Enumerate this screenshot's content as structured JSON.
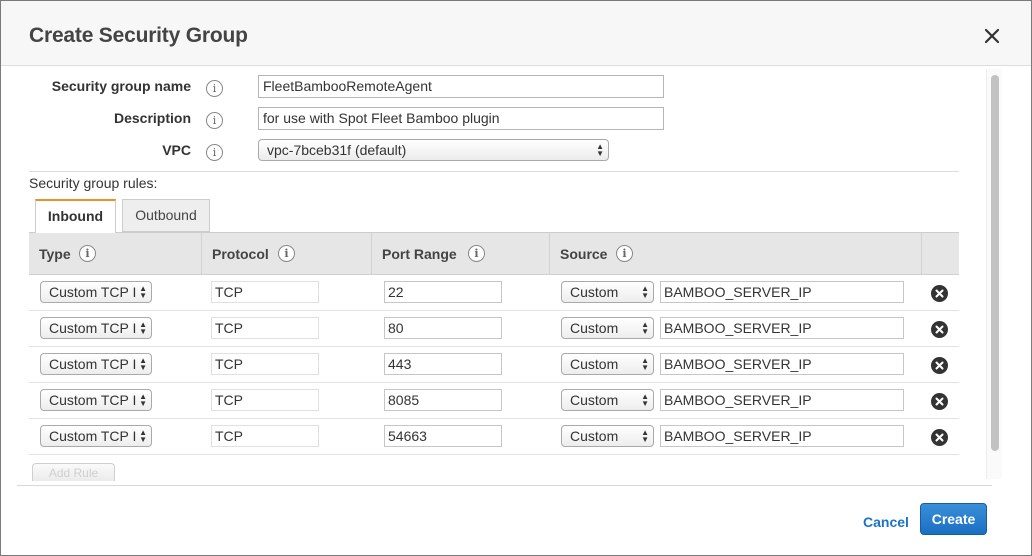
{
  "dialog": {
    "title": "Create Security Group",
    "close_icon": "close-icon"
  },
  "form": {
    "name_label": "Security group name",
    "name_value": "FleetBambooRemoteAgent",
    "description_label": "Description",
    "description_value": "for use with Spot Fleet Bamboo plugin",
    "vpc_label": "VPC",
    "vpc_value": "vpc-7bceb31f (default)",
    "info_glyph": "i"
  },
  "rules": {
    "label": "Security group rules:",
    "tabs": [
      {
        "label": "Inbound",
        "active": true
      },
      {
        "label": "Outbound",
        "active": false
      }
    ],
    "columns": {
      "type": "Type",
      "protocol": "Protocol",
      "port_range": "Port Range",
      "source": "Source"
    },
    "rows": [
      {
        "type": "Custom TCP I",
        "protocol": "TCP",
        "port": "22",
        "source_type": "Custom",
        "source_value": "BAMBOO_SERVER_IP"
      },
      {
        "type": "Custom TCP I",
        "protocol": "TCP",
        "port": "80",
        "source_type": "Custom",
        "source_value": "BAMBOO_SERVER_IP"
      },
      {
        "type": "Custom TCP I",
        "protocol": "TCP",
        "port": "443",
        "source_type": "Custom",
        "source_value": "BAMBOO_SERVER_IP"
      },
      {
        "type": "Custom TCP I",
        "protocol": "TCP",
        "port": "8085",
        "source_type": "Custom",
        "source_value": "BAMBOO_SERVER_IP"
      },
      {
        "type": "Custom TCP I",
        "protocol": "TCP",
        "port": "54663",
        "source_type": "Custom",
        "source_value": "BAMBOO_SERVER_IP"
      }
    ],
    "add_rule_label": "Add Rule"
  },
  "footer": {
    "cancel_label": "Cancel",
    "create_label": "Create"
  },
  "colors": {
    "primary_button": "#1a6fc2",
    "link": "#1a73c8",
    "active_tab_accent": "#e8922e"
  }
}
